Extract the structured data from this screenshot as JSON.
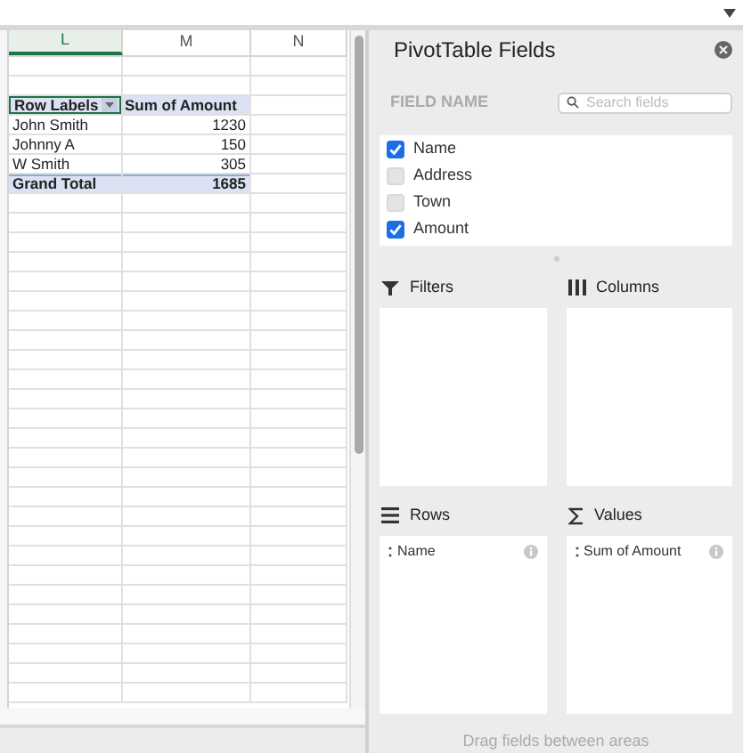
{
  "sheet": {
    "columns": [
      {
        "label": "L",
        "selected": true
      },
      {
        "label": "M",
        "selected": false
      },
      {
        "label": "N",
        "selected": false
      }
    ],
    "pivot": {
      "header": [
        "Row Labels",
        "Sum of Amount"
      ],
      "rows": [
        {
          "label": "John Smith",
          "value": "1230"
        },
        {
          "label": "Johnny A",
          "value": "150"
        },
        {
          "label": "W Smith",
          "value": "305"
        }
      ],
      "total": {
        "label": "Grand Total",
        "value": "1685"
      }
    }
  },
  "panel": {
    "title": "PivotTable Fields",
    "field_name_label": "FIELD NAME",
    "search": {
      "placeholder": "Search fields"
    },
    "fields": [
      {
        "label": "Name",
        "checked": true
      },
      {
        "label": "Address",
        "checked": false
      },
      {
        "label": "Town",
        "checked": false
      },
      {
        "label": "Amount",
        "checked": true
      }
    ],
    "areas": [
      {
        "kind": "filters",
        "label": "Filters"
      },
      {
        "kind": "columns",
        "label": "Columns"
      },
      {
        "kind": "rows",
        "label": "Rows",
        "items": [
          "Name"
        ]
      },
      {
        "kind": "values",
        "label": "Values",
        "items": [
          "Sum of Amount"
        ]
      }
    ],
    "footer": "Drag fields between areas"
  }
}
